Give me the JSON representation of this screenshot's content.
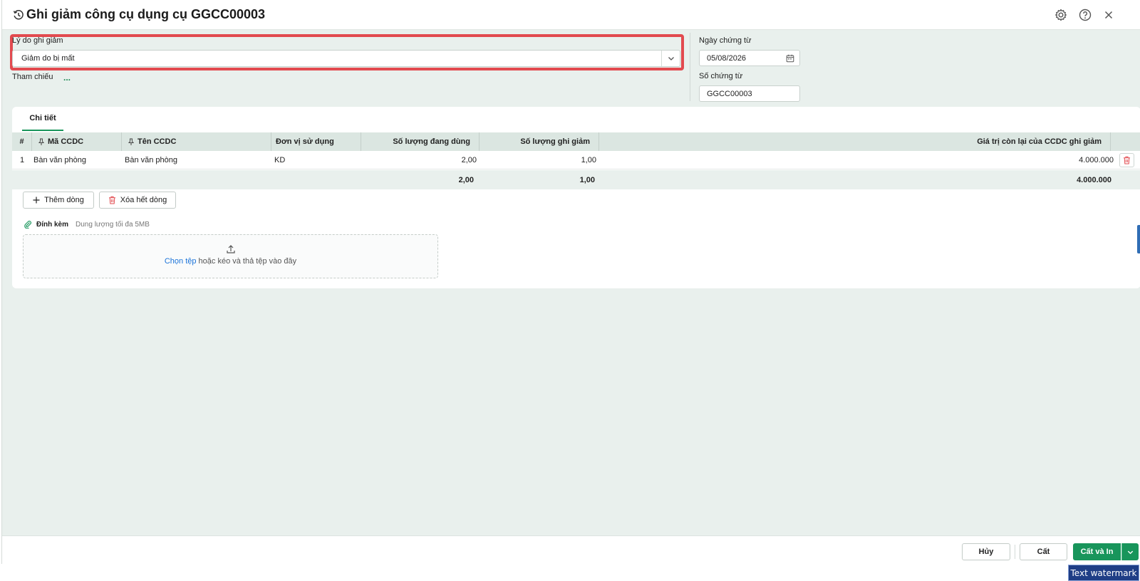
{
  "header": {
    "title": "Ghi giảm công cụ dụng cụ GGCC00003",
    "icons": [
      "history-icon",
      "settings-gear-icon",
      "help-icon",
      "close-icon"
    ]
  },
  "form": {
    "reason_label": "Lý do ghi giảm",
    "reason_value": "Giảm do bị mất",
    "reference_label": "Tham chiếu",
    "reference_more": "...",
    "date_label": "Ngày chứng từ",
    "date_value": "05/08/2026",
    "number_label": "Số chứng từ",
    "number_value": "GGCC00003"
  },
  "detail": {
    "tab_label": "Chi tiết",
    "columns": {
      "index": "#",
      "code": "Mã CCDC",
      "name": "Tên CCDC",
      "unit": "Đơn vị sử dụng",
      "qty_in_use": "Số lượng đang dùng",
      "qty_decrease": "Số lượng ghi giảm",
      "remaining_value": "Giá trị còn lại của CCDC ghi giảm"
    },
    "rows": [
      {
        "index": "1",
        "code": "Bàn văn phòng",
        "name": "Bàn văn phòng",
        "unit": "KD",
        "qty_in_use": "2,00",
        "qty_decrease": "1,00",
        "remaining_value": "4.000.000"
      }
    ],
    "totals": {
      "qty_in_use": "2,00",
      "qty_decrease": "1,00",
      "remaining_value": "4.000.000"
    },
    "add_row_label": "Thêm dòng",
    "clear_rows_label": "Xóa hết dòng"
  },
  "attachment": {
    "label": "Đính kèm",
    "hint": "Dung lượng tối đa 5MB",
    "choose_file": "Chọn tệp",
    "drop_text": " hoặc kéo và thả tệp vào đây"
  },
  "footer": {
    "cancel_label": "Hủy",
    "save_label": "Cất",
    "save_print_label": "Cất và In"
  },
  "watermark": "Text watermark",
  "colors": {
    "accent": "#18955b",
    "highlight_border": "#e24a4f",
    "link": "#1a73d9",
    "delete": "#e24a4f"
  }
}
